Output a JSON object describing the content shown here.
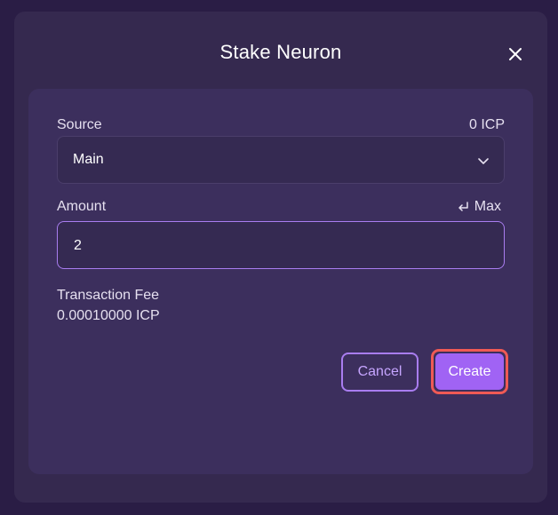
{
  "modal": {
    "title": "Stake Neuron"
  },
  "source": {
    "label": "Source",
    "balance": "0 ICP",
    "selected": "Main"
  },
  "amount": {
    "label": "Amount",
    "max_label": "Max",
    "value": "2"
  },
  "fee": {
    "label": "Transaction Fee",
    "value": "0.00010000 ICP"
  },
  "actions": {
    "cancel_label": "Cancel",
    "create_label": "Create"
  },
  "colors": {
    "accent": "#a063f4",
    "accent_border": "#a97df0",
    "highlight": "#ef5a55",
    "background": "#2a1d45",
    "modal": "#35294f",
    "card": "#3c2f5d"
  },
  "icons": {
    "close": "close-icon",
    "dropdown": "chevron-down-icon",
    "max": "return-arrow-icon"
  }
}
